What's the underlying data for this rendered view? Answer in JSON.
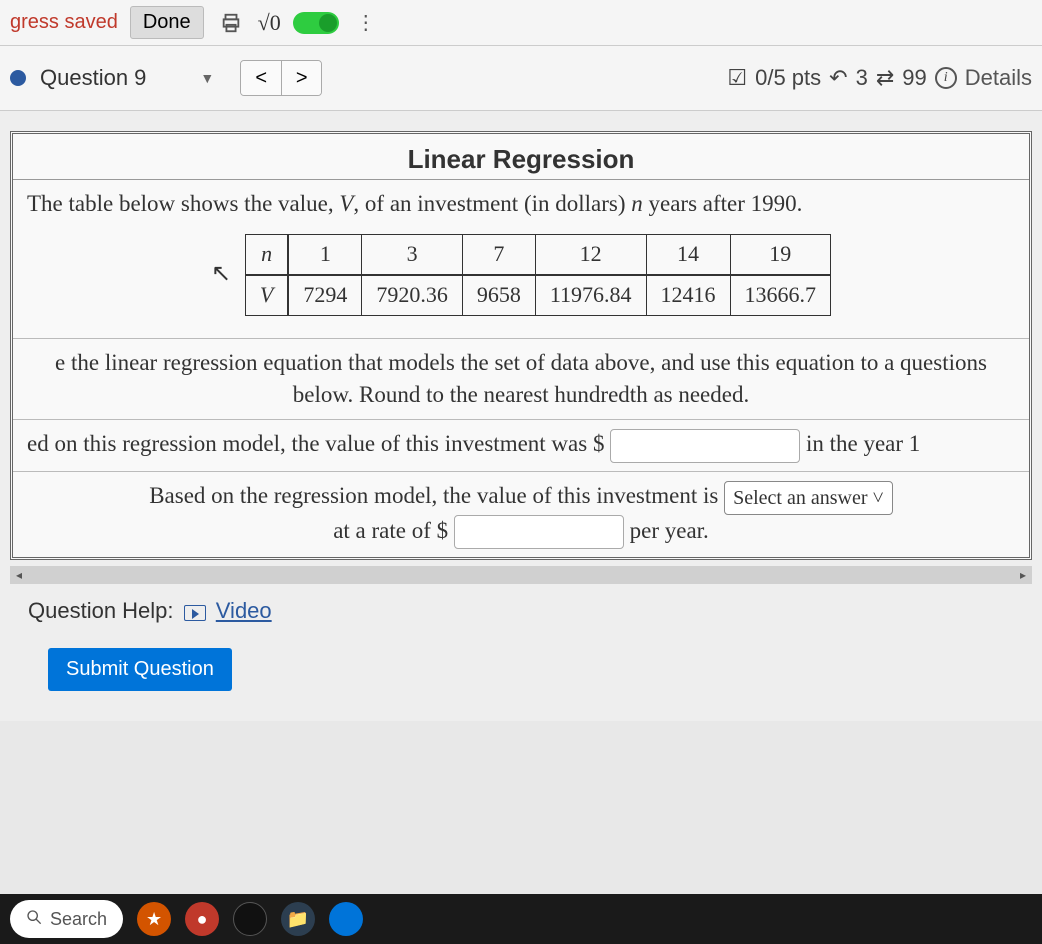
{
  "topbar": {
    "saved_text": "gress saved",
    "done_label": "Done",
    "math_label": "√0"
  },
  "qheader": {
    "title": "Question 9",
    "points": "0/5 pts",
    "retries": "3",
    "attempts": "99",
    "details": "Details"
  },
  "question": {
    "title": "Linear Regression",
    "intro_a": "The table below shows the value, ",
    "intro_var1": "V",
    "intro_b": ", of an investment (in dollars) ",
    "intro_var2": "n",
    "intro_c": " years after 1990.",
    "table": {
      "row1_label": "n",
      "row2_label": "V",
      "n": [
        "1",
        "3",
        "7",
        "12",
        "14",
        "19"
      ],
      "V": [
        "7294",
        "7920.36",
        "9658",
        "11976.84",
        "12416",
        "13666.7"
      ]
    },
    "para2": "e the linear regression equation that models the set of data above, and use this equation to a questions below. Round to the nearest hundredth as needed.",
    "q1_a": "ed on this regression model, the value of this investment was $",
    "q1_b": " in the year 1",
    "q2_a": "Based on the regression model, the value of this investment is ",
    "select_placeholder": "Select an answer",
    "q2_b": "at a rate of $",
    "q2_c": " per year."
  },
  "help": {
    "label": "Question Help:",
    "video": "Video"
  },
  "submit_label": "Submit Question",
  "taskbar": {
    "search": "Search"
  },
  "chart_data": {
    "type": "table",
    "title": "Linear Regression",
    "categories": [
      1,
      3,
      7,
      12,
      14,
      19
    ],
    "values": [
      7294,
      7920.36,
      9658,
      11976.84,
      12416,
      13666.7
    ],
    "xlabel": "n (years after 1990)",
    "ylabel": "V (investment value, dollars)"
  }
}
